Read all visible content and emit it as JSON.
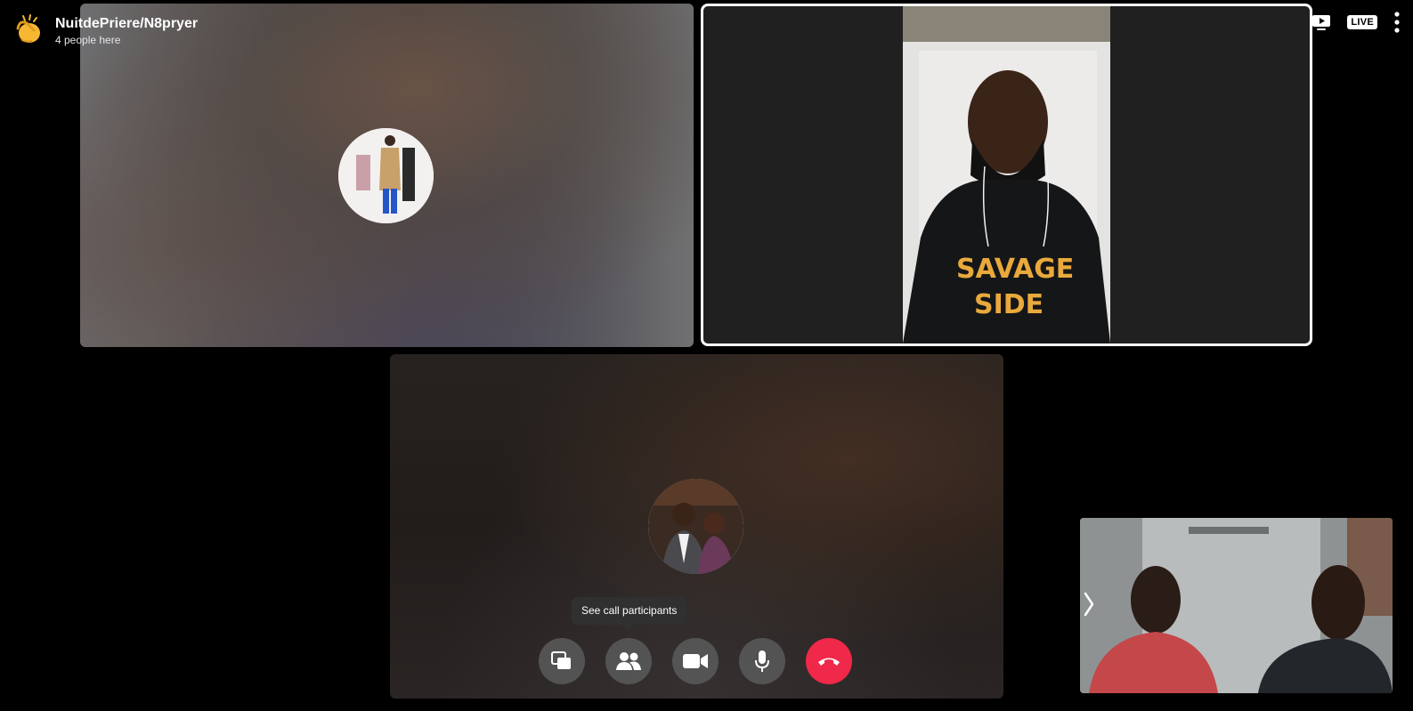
{
  "header": {
    "room_title": "NuitdePriere/N8pryer",
    "participant_count": "4 people here",
    "icon": "clapping-hands-icon"
  },
  "top_right": {
    "present_icon": "present-screen-icon",
    "live_label": "LIVE",
    "more_icon": "more-options-icon"
  },
  "tiles": [
    {
      "id": "participant-1",
      "kind": "avatar-blurred",
      "icon": "avatar"
    },
    {
      "id": "participant-2",
      "kind": "video",
      "active_speaker": true
    },
    {
      "id": "participant-3",
      "kind": "avatar-blurred",
      "icon": "avatar"
    }
  ],
  "self_view": {
    "kind": "video",
    "expand_icon": "chevron-right-icon"
  },
  "tooltip": {
    "text": "See call participants"
  },
  "controls": [
    {
      "name": "switch-view-button",
      "icon": "windows-icon"
    },
    {
      "name": "participants-button",
      "icon": "people-icon"
    },
    {
      "name": "video-button",
      "icon": "camera-icon"
    },
    {
      "name": "mic-button",
      "icon": "microphone-icon"
    },
    {
      "name": "end-call-button",
      "icon": "phone-hangup-icon",
      "color": "#f02849"
    }
  ],
  "colors": {
    "background": "#000000",
    "control_bg": "#5a5a5a",
    "end_call": "#f02849",
    "active_border": "#ffffff"
  }
}
